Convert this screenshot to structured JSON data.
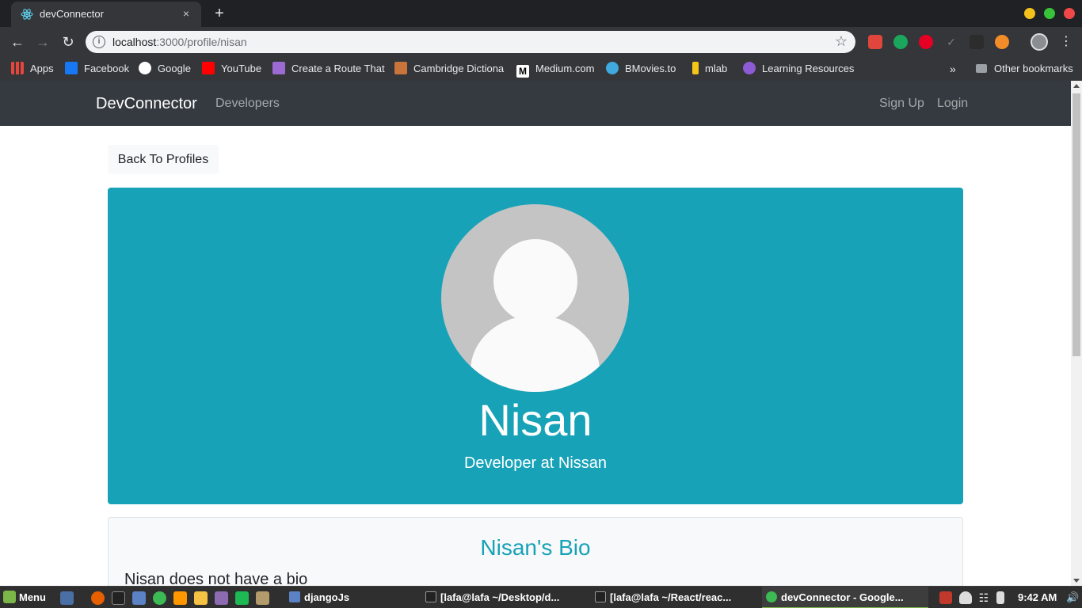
{
  "browser": {
    "tab_title": "devConnector",
    "tab_close": "×",
    "new_tab": "+",
    "url_host": "localhost",
    "url_path": ":3000/profile/nisan",
    "bookmarks": [
      {
        "label": "Apps",
        "icon": "apps-grid-icon",
        "color": "#e8453c"
      },
      {
        "label": "Facebook",
        "icon": "facebook-icon",
        "color": "#1877f2"
      },
      {
        "label": "Google",
        "icon": "google-icon",
        "color": "#ffffff"
      },
      {
        "label": "YouTube",
        "icon": "youtube-icon",
        "color": "#ff0000"
      },
      {
        "label": "Create a Route That",
        "icon": "cloud-icon",
        "color": "#9b6bd3"
      },
      {
        "label": "Cambridge Dictiona",
        "icon": "cambridge-icon",
        "color": "#c9743b"
      },
      {
        "label": "Medium.com",
        "icon": "medium-icon",
        "color": "#ffffff"
      },
      {
        "label": "BMovies.to",
        "icon": "play-icon",
        "color": "#3fa9e0"
      },
      {
        "label": "mlab",
        "icon": "mlab-icon",
        "color": "#f5c518"
      },
      {
        "label": "Learning Resources",
        "icon": "graphql-icon",
        "color": "#8e5bd6"
      }
    ],
    "more_bookmarks": "»",
    "other_bookmarks": "Other bookmarks"
  },
  "app": {
    "brand": "DevConnector",
    "nav_left": [
      "Developers"
    ],
    "nav_right": [
      "Sign Up",
      "Login"
    ],
    "back_button": "Back To Profiles",
    "profile": {
      "name": "Nisan",
      "job": "Developer at Nissan"
    },
    "bio": {
      "title": "Nisan's Bio",
      "text": "Nisan does not have a bio"
    },
    "colors": {
      "navbar": "#343a40",
      "accent": "#17a2b8"
    }
  },
  "taskbar": {
    "menu_label": "Menu",
    "items": [
      {
        "label": "djangoJs",
        "icon": "folder-icon"
      },
      {
        "label": "[lafa@lafa ~/Desktop/d...",
        "icon": "terminal-icon"
      },
      {
        "label": "[lafa@lafa ~/React/reac...",
        "icon": "terminal-icon"
      },
      {
        "label": "devConnector - Google...",
        "icon": "chrome-icon"
      }
    ],
    "clock": "9:42 AM"
  }
}
